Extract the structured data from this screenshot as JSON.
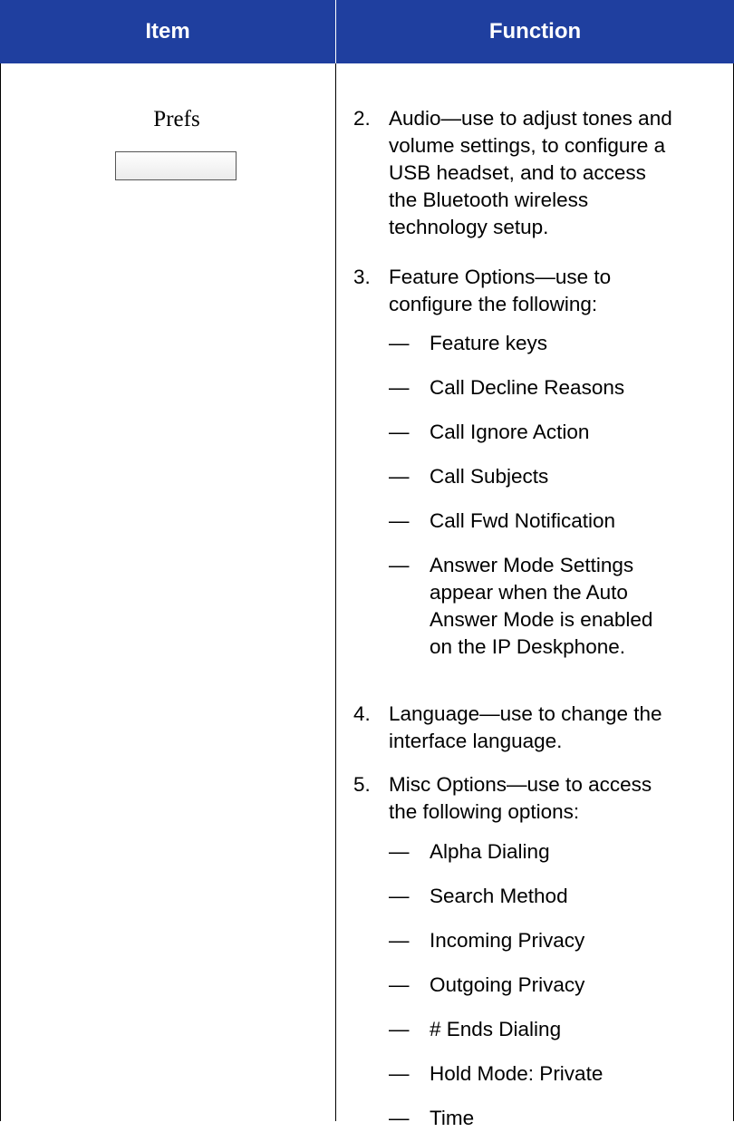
{
  "table": {
    "headers": {
      "item": "Item",
      "function": "Function"
    },
    "item": {
      "label": "Prefs"
    },
    "function": {
      "entries": [
        {
          "number": "2.",
          "lines": [
            "Audio—use to adjust tones and",
            "volume settings, to configure a",
            "USB headset, and to access",
            "the Bluetooth wireless",
            "technology setup."
          ]
        },
        {
          "number": "3.",
          "lines": [
            "Feature Options—use to",
            "configure the following:"
          ]
        },
        {
          "number": "4.",
          "lines": [
            "Language—use to change the",
            "interface language."
          ]
        },
        {
          "number": "5.",
          "lines": [
            "Misc Options—use to access",
            "the following options:"
          ]
        }
      ],
      "dash": "—",
      "feature_sub_items": [
        {
          "lines": [
            "Feature keys"
          ]
        },
        {
          "lines": [
            "Call Decline Reasons"
          ]
        },
        {
          "lines": [
            "Call Ignore Action"
          ]
        },
        {
          "lines": [
            "Call Subjects"
          ]
        },
        {
          "lines": [
            "Call Fwd Notification"
          ]
        },
        {
          "lines": [
            "Answer Mode Settings",
            "appear when the Auto",
            "Answer Mode is enabled",
            "on the IP Deskphone."
          ]
        }
      ],
      "misc_sub_items": [
        {
          "lines": [
            "Alpha Dialing"
          ]
        },
        {
          "lines": [
            "Search Method"
          ]
        },
        {
          "lines": [
            "Incoming Privacy"
          ]
        },
        {
          "lines": [
            "Outgoing Privacy"
          ]
        },
        {
          "lines": [
            "# Ends Dialing"
          ]
        },
        {
          "lines": [
            "Hold Mode: Private"
          ]
        },
        {
          "lines": [
            "Time"
          ]
        }
      ]
    }
  },
  "colors": {
    "header_bg": "#1f3f9f",
    "header_text": "#ffffff"
  }
}
